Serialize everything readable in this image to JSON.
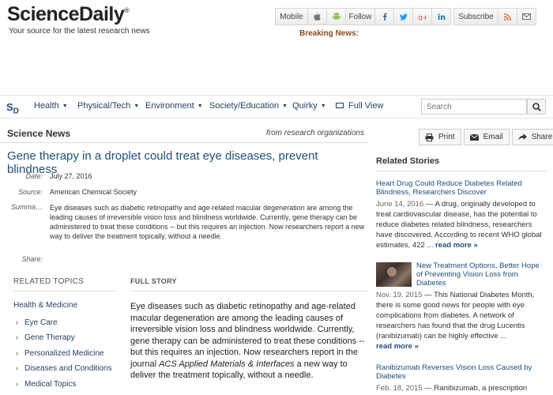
{
  "header": {
    "logo": "ScienceDaily",
    "logo_mark": "®",
    "tagline": "Your source for the latest research news",
    "breaking_label": "Breaking News:"
  },
  "topbar": {
    "mobile": "Mobile",
    "follow": "Follow",
    "subscribe": "Subscribe",
    "icons": [
      "apple-icon",
      "android-icon",
      "facebook-icon",
      "twitter-icon",
      "google-plus-icon",
      "linkedin-icon",
      "rss-icon",
      "email-icon"
    ]
  },
  "nav": {
    "logo": "S",
    "logo_sub": "D",
    "items": [
      "Health",
      "Physical/Tech",
      "Environment",
      "Society/Education",
      "Quirky"
    ],
    "full_view": "Full View",
    "search_placeholder": "Search"
  },
  "section": {
    "title": "Science News",
    "from": "from research organizations"
  },
  "share_buttons": {
    "print": "Print",
    "email": "Email",
    "share": "Share"
  },
  "article": {
    "headline": "Gene therapy in a droplet could treat eye diseases, prevent blindness",
    "date_label": "Date:",
    "date": "July 27, 2016",
    "source_label": "Source:",
    "source": "American Chemical Society",
    "summary_label": "Summa…",
    "summary": "Eye diseases such as diabetic retinopathy and age-related macular degeneration are among the leading causes of irreversible vision loss and blindness worldwide. Currently, gene therapy can be administered to treat these conditions -- but this requires an injection. Now researchers report a new way to deliver the treatment topically, without a needle.",
    "share_label": "Share:",
    "full_story_label": "FULL STORY",
    "story_pre": "Eye diseases such as diabetic retinopathy and age-related macular degeneration are among the leading causes of irreversible vision loss and blindness worldwide. Currently, gene therapy can be administered to treat these conditions -- but this requires an injection. Now researchers report in the journal ",
    "story_journal": "ACS Applied Materials & Interfaces",
    "story_post": " a new way to deliver the treatment topically, without a needle."
  },
  "related_topics": {
    "label": "RELATED TOPICS",
    "head": "Health & Medicine",
    "items": [
      "Eye Care",
      "Gene Therapy",
      "Personalized Medicine",
      "Diseases and Conditions",
      "Medical Topics"
    ]
  },
  "related_stories": {
    "label": "Related Stories",
    "read_more": "read more »",
    "items": [
      {
        "title": "Heart Drug Could Reduce Diabetes Related Blindness, Researchers Discover",
        "date": "June 14, 2016",
        "body": "A drug, originally developed to treat cardiovascular disease, has the potential to reduce diabetes related blindness, researchers have discovered. According to recent WHO global estimates, 422 ..."
      },
      {
        "title": "New Treatment Options, Better Hope of Preventing Vision Loss from Diabetes",
        "date": "Nov. 19, 2015",
        "body": "This National Diabetes Month, there is some good news for people with eye complications from diabetes. A network of researchers has found that the drug Lucentis (ranibizumab) can be highly effective ..."
      },
      {
        "title": "Ranibizumab Reverses Vision Loss Caused by Diabetes",
        "date": "Feb. 18, 2015",
        "body": "Ranibizumab, a prescription"
      }
    ]
  }
}
